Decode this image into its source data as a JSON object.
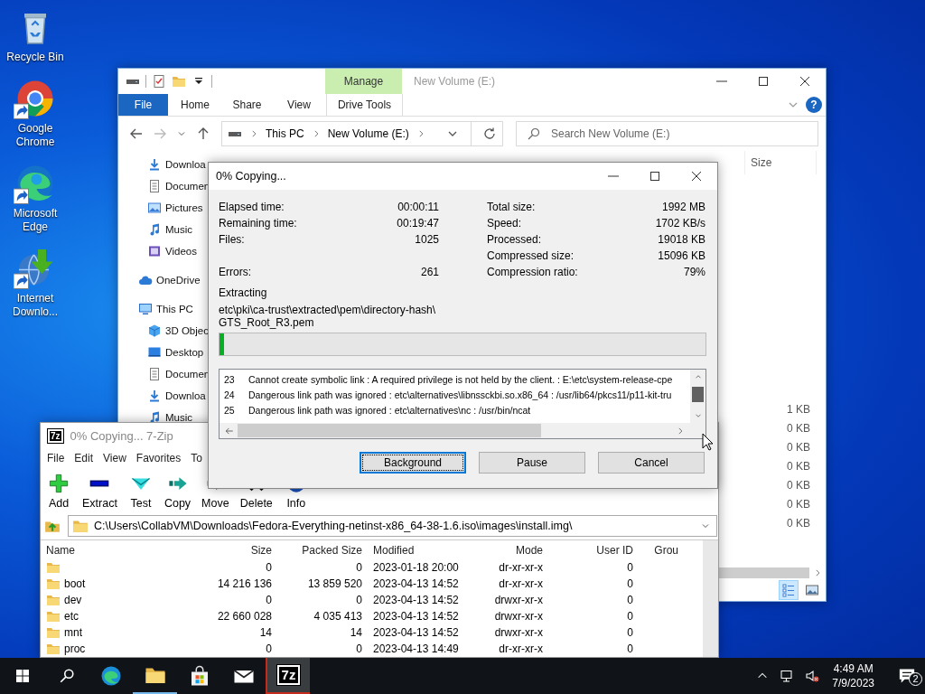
{
  "desktop_icons": [
    {
      "label": "Recycle Bin",
      "kind": "recycle",
      "shortcut": false
    },
    {
      "label": "Google Chrome",
      "kind": "chrome",
      "shortcut": true
    },
    {
      "label": "Microsoft Edge",
      "kind": "edge",
      "shortcut": true
    },
    {
      "label": "Internet Downlo...",
      "kind": "idm",
      "shortcut": true
    }
  ],
  "explorer": {
    "title": "New Volume (E:)",
    "context_tab": "Manage",
    "help": "?",
    "tabs": [
      {
        "label": "File",
        "kind": "file"
      },
      {
        "label": "Home",
        "kind": "tab"
      },
      {
        "label": "Share",
        "kind": "tab"
      },
      {
        "label": "View",
        "kind": "tab"
      },
      {
        "label": "Drive Tools",
        "kind": "context"
      }
    ],
    "breadcrumb": [
      "This PC",
      "New Volume (E:)"
    ],
    "search": {
      "placeholder": "Search New Volume (E:)"
    },
    "nav": {
      "pinned": [
        {
          "label": "Downloa",
          "kind": "downloads"
        },
        {
          "label": "Documen",
          "kind": "documents"
        },
        {
          "label": "Pictures",
          "kind": "pictures"
        },
        {
          "label": "Music",
          "kind": "music"
        },
        {
          "label": "Videos",
          "kind": "videos"
        }
      ],
      "roots": [
        {
          "label": "OneDrive",
          "kind": "cloud"
        },
        {
          "label": "This PC",
          "kind": "pc",
          "children": [
            {
              "label": "3D Objec",
              "kind": "cube"
            },
            {
              "label": "Desktop",
              "kind": "desktop"
            },
            {
              "label": "Documen",
              "kind": "documents"
            },
            {
              "label": "Downloa",
              "kind": "downloads"
            },
            {
              "label": "Music",
              "kind": "music"
            }
          ]
        }
      ]
    },
    "size_column": "Size",
    "sizes": [
      "1 KB",
      "0 KB",
      "0 KB",
      "0 KB",
      "0 KB",
      "0 KB",
      "0 KB"
    ],
    "views": [
      {
        "kind": "details",
        "selected": true
      },
      {
        "kind": "preview",
        "selected": false
      }
    ]
  },
  "copy_dialog": {
    "title": "0% Copying...",
    "stats": [
      {
        "left": {
          "label": "Elapsed time:",
          "value": "00:00:11"
        },
        "right": {
          "label": "Total size:",
          "value": "1992 MB"
        }
      },
      {
        "left": {
          "label": "Remaining time:",
          "value": "00:19:47"
        },
        "right": {
          "label": "Speed:",
          "value": "1702 KB/s"
        }
      },
      {
        "left": {
          "label": "Files:",
          "value": "1025"
        },
        "right": {
          "label": "Processed:",
          "value": "19018 KB"
        }
      },
      {
        "right": {
          "label": "Compressed size:",
          "value": "15096 KB"
        }
      },
      {
        "left": {
          "label": "Errors:",
          "value": "261"
        },
        "right": {
          "label": "Compression ratio:",
          "value": "79%"
        }
      }
    ],
    "operation": "Extracting",
    "path_lines": [
      "etc\\pki\\ca-trust\\extracted\\pem\\directory-hash\\",
      "GTS_Root_R3.pem"
    ],
    "progress": {
      "level": 0.01
    },
    "log": [
      {
        "number": "23",
        "text": "Cannot create symbolic link : A required privilege is not held by the client. : E:\\etc\\system-release-cpe"
      },
      {
        "number": "24",
        "text": "Dangerous link path was ignored : etc\\alternatives\\libnssckbi.so.x86_64 : /usr/lib64/pkcs11/p11-kit-tru"
      },
      {
        "number": "25",
        "text": "Dangerous link path was ignored : etc\\alternatives\\nc : /usr/bin/ncat"
      }
    ],
    "buttons": [
      {
        "label": "Background",
        "default": true
      },
      {
        "label": "Pause",
        "default": false
      },
      {
        "label": "Cancel",
        "default": false
      }
    ]
  },
  "sevenzip": {
    "logo": "7z",
    "title": "0% Copying... 7-Zip",
    "menu": [
      "File",
      "Edit",
      "View",
      "Favorites",
      "To"
    ],
    "tools": [
      {
        "label": "Add",
        "kind": "add"
      },
      {
        "label": "Extract",
        "kind": "extract"
      },
      {
        "label": "Test",
        "kind": "test"
      },
      {
        "label": "Copy",
        "kind": "copy"
      },
      {
        "label": "Move",
        "kind": "move"
      },
      {
        "label": "Delete",
        "kind": "delete"
      },
      {
        "label": "Info",
        "kind": "info"
      }
    ],
    "path": "C:\\Users\\CollabVM\\Downloads\\Fedora-Everything-netinst-x86_64-38-1.6.iso\\images\\install.img\\",
    "columns": [
      "Name",
      "Size",
      "Packed Size",
      "Modified",
      "Mode",
      "User ID",
      "Grou"
    ],
    "rows": [
      {
        "size": "0",
        "packed": "0",
        "modified": "2023-01-18 20:00",
        "mode": "dr-xr-xr-x",
        "user_id": "0"
      },
      {
        "name": "boot",
        "size": "14 216 136",
        "packed": "13 859 520",
        "modified": "2023-04-13 14:52",
        "mode": "dr-xr-xr-x",
        "user_id": "0"
      },
      {
        "name": "dev",
        "size": "0",
        "packed": "0",
        "modified": "2023-04-13 14:52",
        "mode": "drwxr-xr-x",
        "user_id": "0"
      },
      {
        "name": "etc",
        "size": "22 660 028",
        "packed": "4 035 413",
        "modified": "2023-04-13 14:52",
        "mode": "drwxr-xr-x",
        "user_id": "0"
      },
      {
        "name": "mnt",
        "size": "14",
        "packed": "14",
        "modified": "2023-04-13 14:52",
        "mode": "drwxr-xr-x",
        "user_id": "0"
      },
      {
        "name": "proc",
        "size": "0",
        "packed": "0",
        "modified": "2023-04-13 14:49",
        "mode": "dr-xr-xr-x",
        "user_id": "0"
      }
    ]
  },
  "taskbar": {
    "apps": [
      {
        "kind": "edge",
        "running": false,
        "selected": false
      },
      {
        "kind": "folder",
        "running": true,
        "selected": false
      },
      {
        "kind": "store",
        "running": false,
        "selected": false
      },
      {
        "kind": "mail",
        "running": false,
        "selected": false
      },
      {
        "kind": "sevenzip",
        "label": "7z",
        "running": true,
        "selected": true
      }
    ],
    "time": "4:49 AM",
    "date": "7/9/2023",
    "notifications": "2"
  }
}
